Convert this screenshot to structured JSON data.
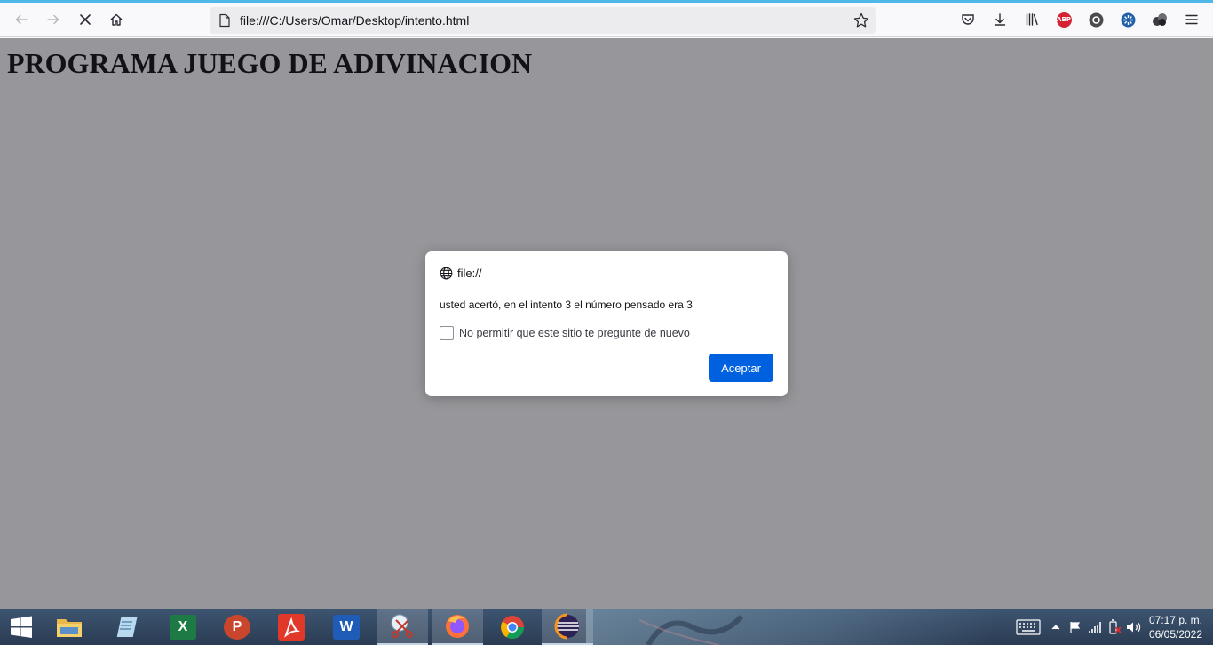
{
  "browser": {
    "url": "file:///C:/Users/Omar/Desktop/intento.html",
    "extensions": [
      {
        "name": "pocket-icon"
      },
      {
        "name": "downloads-icon"
      },
      {
        "name": "library-icon"
      },
      {
        "name": "adblock-plus-icon",
        "text": "ABP"
      },
      {
        "name": "extension-circle-icon"
      },
      {
        "name": "extension-gear-icon"
      },
      {
        "name": "extension-spheres-icon"
      },
      {
        "name": "menu-icon"
      }
    ]
  },
  "page": {
    "title": "PROGRAMA JUEGO DE ADIVINACION"
  },
  "dialog": {
    "origin": "file://",
    "message": "usted acertó, en el intento 3 el número pensado era 3",
    "checkbox_label": "No permitir que este sitio te pregunte de nuevo",
    "checkbox_checked": false,
    "ok_label": "Aceptar"
  },
  "taskbar": {
    "apps": [
      {
        "name": "file-explorer",
        "label": ""
      },
      {
        "name": "notepad",
        "label": ""
      },
      {
        "name": "excel",
        "label": "X"
      },
      {
        "name": "powerpoint",
        "label": "P"
      },
      {
        "name": "acrobat",
        "label": ""
      },
      {
        "name": "word",
        "label": "W"
      },
      {
        "name": "snipping-tool",
        "label": ""
      },
      {
        "name": "firefox",
        "label": ""
      },
      {
        "name": "chrome",
        "label": ""
      },
      {
        "name": "eclipse",
        "label": ""
      }
    ],
    "clock": {
      "time": "07:17 p. m.",
      "date": "06/05/2022"
    }
  },
  "colors": {
    "accent": "#0061e0",
    "loading_bar": "#4fb8e8",
    "taskbar": "#2f425b"
  }
}
